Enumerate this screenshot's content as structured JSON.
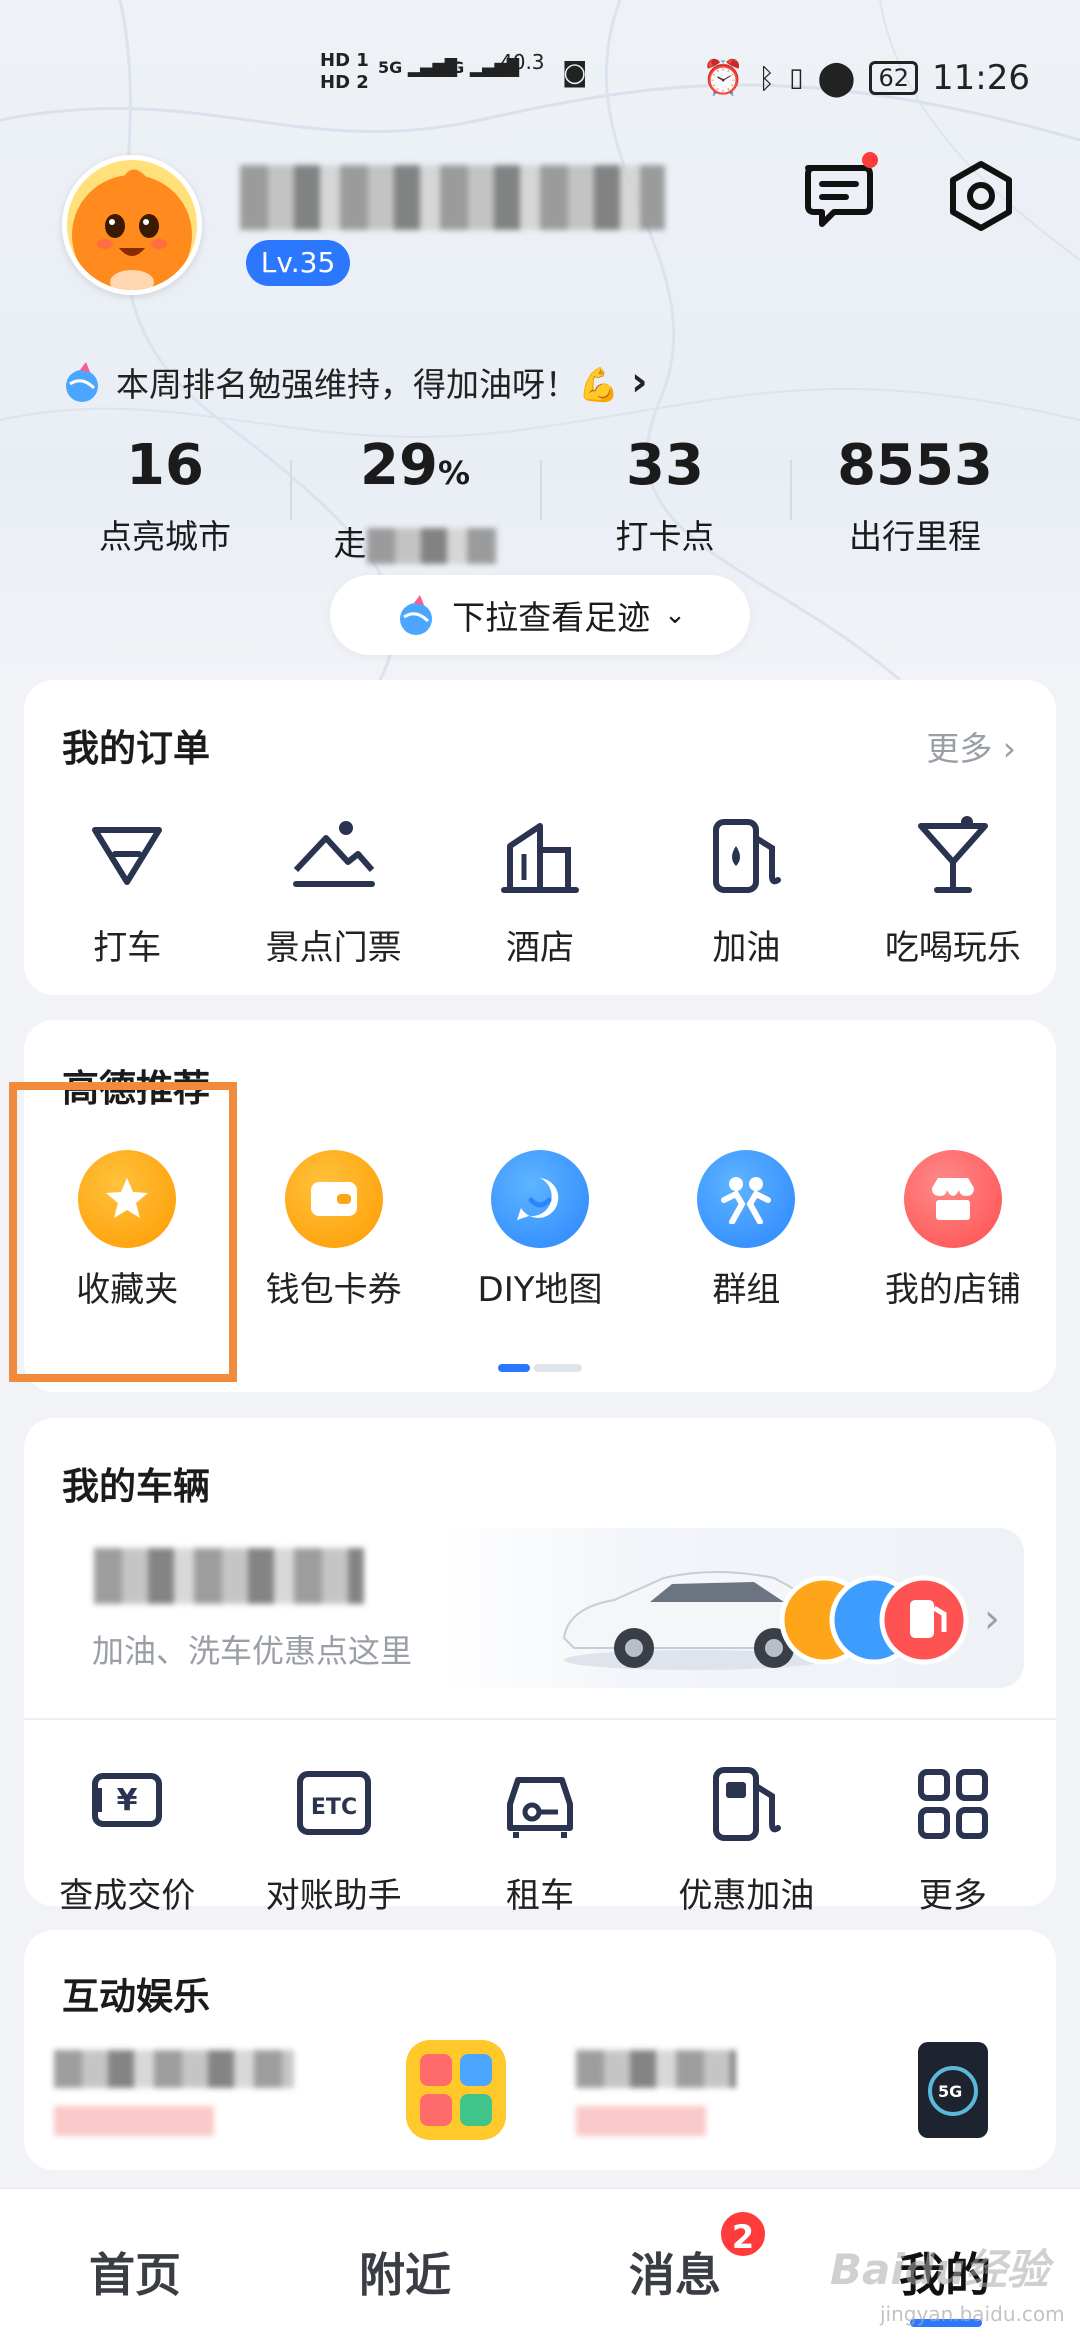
{
  "status_bar": {
    "net1": "HD 1",
    "net2": "HD 2",
    "sig1": "5G",
    "sig2": "4G",
    "speed": "40.3",
    "battery": "62",
    "time": "11:26"
  },
  "profile": {
    "level": "Lv.35"
  },
  "rank": {
    "text": "本周排名勉强维持，得加油呀！💪"
  },
  "stats": [
    {
      "value": "16",
      "label": "点亮城市"
    },
    {
      "value": "29",
      "unit": "%",
      "label": "走"
    },
    {
      "value": "33",
      "label": "打卡点"
    },
    {
      "value": "8553",
      "label": "出行里程"
    }
  ],
  "pull": {
    "label": "下拉查看足迹"
  },
  "orders": {
    "title": "我的订单",
    "more": "更多",
    "items": [
      {
        "label": "打车",
        "icon": "taxi-icon"
      },
      {
        "label": "景点门票",
        "icon": "scenic-ticket-icon"
      },
      {
        "label": "酒店",
        "icon": "hotel-icon"
      },
      {
        "label": "加油",
        "icon": "fuel-icon"
      },
      {
        "label": "吃喝玩乐",
        "icon": "cocktail-icon"
      }
    ]
  },
  "recommend": {
    "title": "高德推荐",
    "items": [
      {
        "label": "收藏夹",
        "icon": "star-icon",
        "color": "#ffa51a"
      },
      {
        "label": "钱包卡券",
        "icon": "wallet-icon",
        "color": "#ffa51a"
      },
      {
        "label": "DIY地图",
        "icon": "smile-map-icon",
        "color": "#3c9dff"
      },
      {
        "label": "群组",
        "icon": "group-icon",
        "color": "#3c9dff"
      },
      {
        "label": "我的店铺",
        "icon": "shop-icon",
        "color": "#ff5b5b"
      }
    ]
  },
  "vehicle": {
    "title": "我的车辆",
    "subtitle": "加油、洗车优惠点这里",
    "items": [
      {
        "label": "查成交价",
        "icon": "price-icon"
      },
      {
        "label": "对账助手",
        "icon": "etc-icon"
      },
      {
        "label": "租车",
        "icon": "rent-car-icon"
      },
      {
        "label": "优惠加油",
        "icon": "fuel-icon"
      },
      {
        "label": "更多",
        "icon": "grid-icon"
      }
    ]
  },
  "entertainment": {
    "title": "互动娱乐",
    "badge_5g": "5G"
  },
  "tabs": [
    {
      "label": "首页"
    },
    {
      "label": "附近"
    },
    {
      "label": "消息",
      "badge": "2"
    },
    {
      "label": "我的",
      "active": true
    }
  ],
  "watermark": {
    "brand": "Baidu经验",
    "url": "jingyan.baidu.com"
  }
}
